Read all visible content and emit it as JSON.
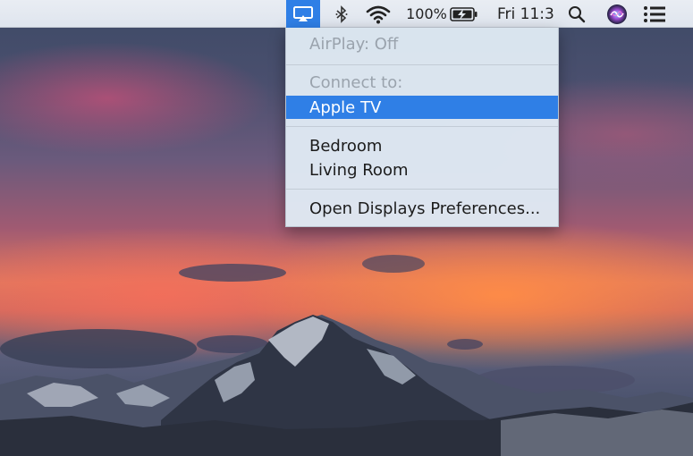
{
  "menubar": {
    "battery_percent": "100%",
    "clock": "Fri 11:3",
    "icons": [
      "airplay-icon",
      "bluetooth-icon",
      "wifi-icon",
      "battery-charging-icon",
      "search-icon",
      "siri-icon",
      "notification-center-icon"
    ],
    "accent_color": "#2f7fe6"
  },
  "airplay_menu": {
    "status": "AirPlay: Off",
    "connect_header": "Connect to:",
    "devices": [
      "Apple TV",
      "Bedroom",
      "Living Room"
    ],
    "selected_device": "Apple TV",
    "open_prefs": "Open Displays Preferences..."
  }
}
